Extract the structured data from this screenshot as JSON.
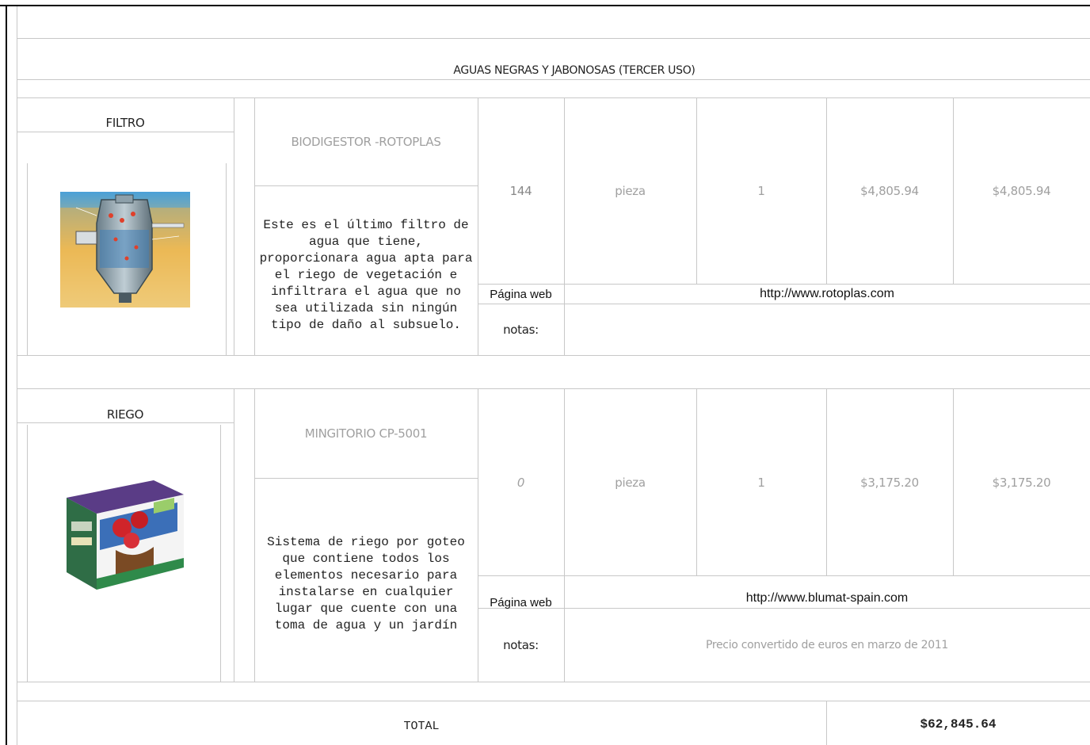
{
  "section_title": "AGUAS NEGRAS Y JABONOSAS (TERCER USO)",
  "items": [
    {
      "category": "FILTRO",
      "product": "BIODIGESTOR -ROTOPLAS",
      "description": "Este es el último filtro de agua que tiene, proporcionara agua apta para el riego de vegetación e infiltrara el agua que no sea utilizada sin ningún tipo de daño al subsuelo.",
      "code": "144",
      "unit": "pieza",
      "quantity": "1",
      "unit_price": "$4,805.94",
      "total": "$4,805.94",
      "web_label": "Página web",
      "web_url": "http://www.rotoplas.com",
      "notes_label": "notas:",
      "notes": ""
    },
    {
      "category": "RIEGO",
      "product": "MINGITORIO CP-5001",
      "description": "Sistema de riego por goteo que contiene todos los elementos necesario para instalarse en cualquier lugar que cuente con una toma de agua y un jardín",
      "code": "0",
      "unit": "pieza",
      "quantity": "1",
      "unit_price": "$3,175.20",
      "total": "$3,175.20",
      "web_label": "Página web",
      "web_url": "http://www.blumat-spain.com",
      "notes_label": "notas:",
      "notes": "Precio convertido de euros en marzo de 2011"
    }
  ],
  "footer": {
    "total_label": "TOTAL",
    "total_value": "$62,845.64"
  }
}
